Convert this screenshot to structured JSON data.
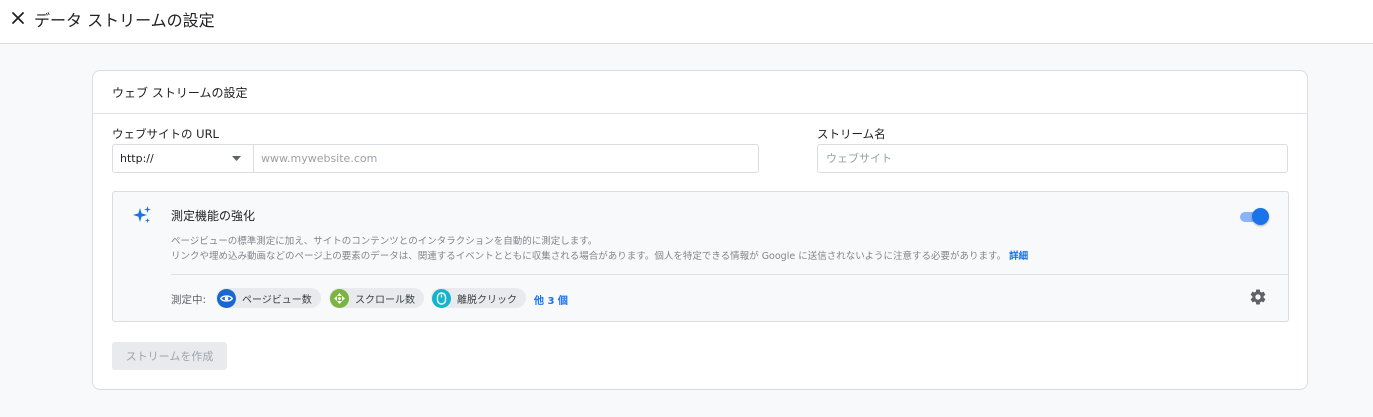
{
  "header": {
    "title": "データ ストリームの設定"
  },
  "card": {
    "title": "ウェブ ストリームの設定",
    "url_field": {
      "label": "ウェブサイトの URL",
      "protocol": "http://",
      "placeholder": "www.mywebsite.com",
      "value": ""
    },
    "stream_name_field": {
      "label": "ストリーム名",
      "placeholder": "ウェブサイト",
      "value": ""
    },
    "enhanced_measurement": {
      "title": "測定機能の強化",
      "description_line1": "ページビューの標準測定に加え、サイトのコンテンツとのインタラクションを自動的に測定します。",
      "description_line2": "リンクや埋め込み動画などのページ上の要素のデータは、関連するイベントとともに収集される場合があります。個人を特定できる情報が Google に送信されないように注意する必要があります。",
      "details_link": "詳細",
      "enabled": true,
      "measuring_label": "測定中:",
      "chips": [
        {
          "label": "ページビュー数",
          "icon": "eye-icon",
          "color": "#1967d2"
        },
        {
          "label": "スクロール数",
          "icon": "scroll-icon",
          "color": "#7cb342"
        },
        {
          "label": "離脱クリック",
          "icon": "mouse-icon",
          "color": "#12b5cb"
        }
      ],
      "more_link": "他 3 個"
    },
    "create_button": "ストリームを作成"
  },
  "colors": {
    "accent": "#1a73e8",
    "toggle_track": "#8ab4f8",
    "disabled_button": "#e8eaed"
  }
}
